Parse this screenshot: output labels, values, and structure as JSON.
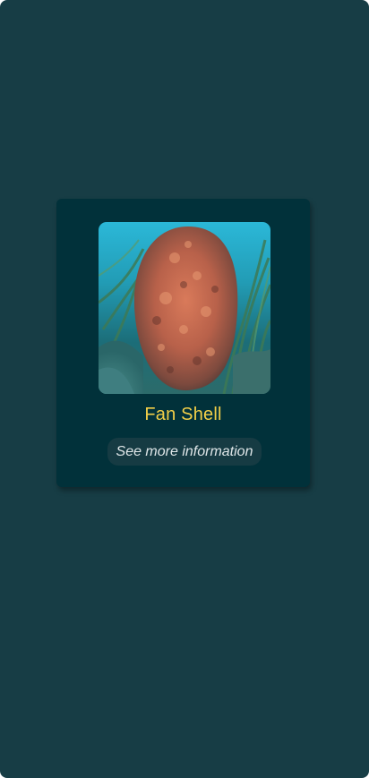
{
  "species_card": {
    "image_alt": "Fan Shell photo",
    "title": "Fan Shell",
    "more_button_label": "See more information"
  }
}
